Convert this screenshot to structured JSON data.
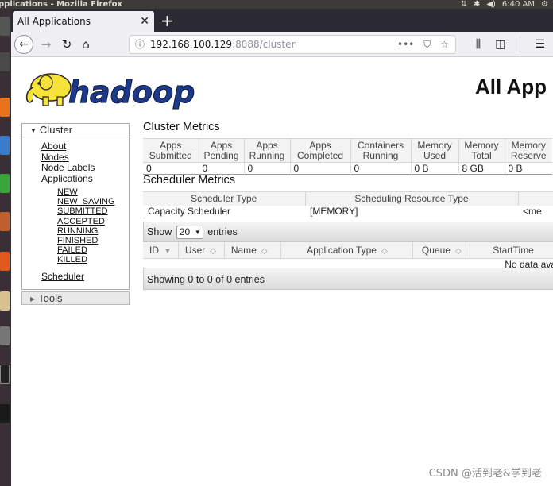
{
  "os": {
    "window_title": "pplications - Mozilla Firefox",
    "clock": "6:40 AM",
    "tray_icons": [
      "network-icon",
      "bluetooth-icon",
      "volume-icon",
      "settings-icon"
    ]
  },
  "browser": {
    "tab_title": "All Applications",
    "url_host": "192.168.100.129",
    "url_rest": ":8088/cluster"
  },
  "page": {
    "title": "All App",
    "logo_text": "hadoop"
  },
  "nav": {
    "cluster_label": "Cluster",
    "links": [
      "About",
      "Nodes",
      "Node Labels",
      "Applications"
    ],
    "app_states": [
      "NEW",
      "NEW_SAVING",
      "SUBMITTED",
      "ACCEPTED",
      "RUNNING",
      "FINISHED",
      "FAILED",
      "KILLED"
    ],
    "scheduler_label": "Scheduler",
    "tools_label": "Tools"
  },
  "cluster_metrics": {
    "title": "Cluster Metrics",
    "headers": [
      [
        "Apps",
        "Submitted"
      ],
      [
        "Apps",
        "Pending"
      ],
      [
        "Apps",
        "Running"
      ],
      [
        "Apps",
        "Completed"
      ],
      [
        "Containers",
        "Running"
      ],
      [
        "Memory",
        "Used"
      ],
      [
        "Memory",
        "Total"
      ],
      [
        "Memory",
        "Reserve"
      ]
    ],
    "values": [
      "0",
      "0",
      "0",
      "0",
      "0",
      "0 B",
      "8 GB",
      "0 B"
    ]
  },
  "scheduler_metrics": {
    "title": "Scheduler Metrics",
    "headers": [
      "Scheduler Type",
      "Scheduling Resource Type",
      ""
    ],
    "values": [
      "Capacity Scheduler",
      "[MEMORY]",
      "<me"
    ]
  },
  "apps_table": {
    "show_label": "Show",
    "page_size": "20",
    "entries_label": "entries",
    "columns": [
      "ID",
      "User",
      "Name",
      "Application Type",
      "Queue",
      "StartTime"
    ],
    "empty_text": "No data ava",
    "info_text": "Showing 0 to 0 of 0 entries"
  },
  "watermark": "CSDN @活到老&学到老"
}
